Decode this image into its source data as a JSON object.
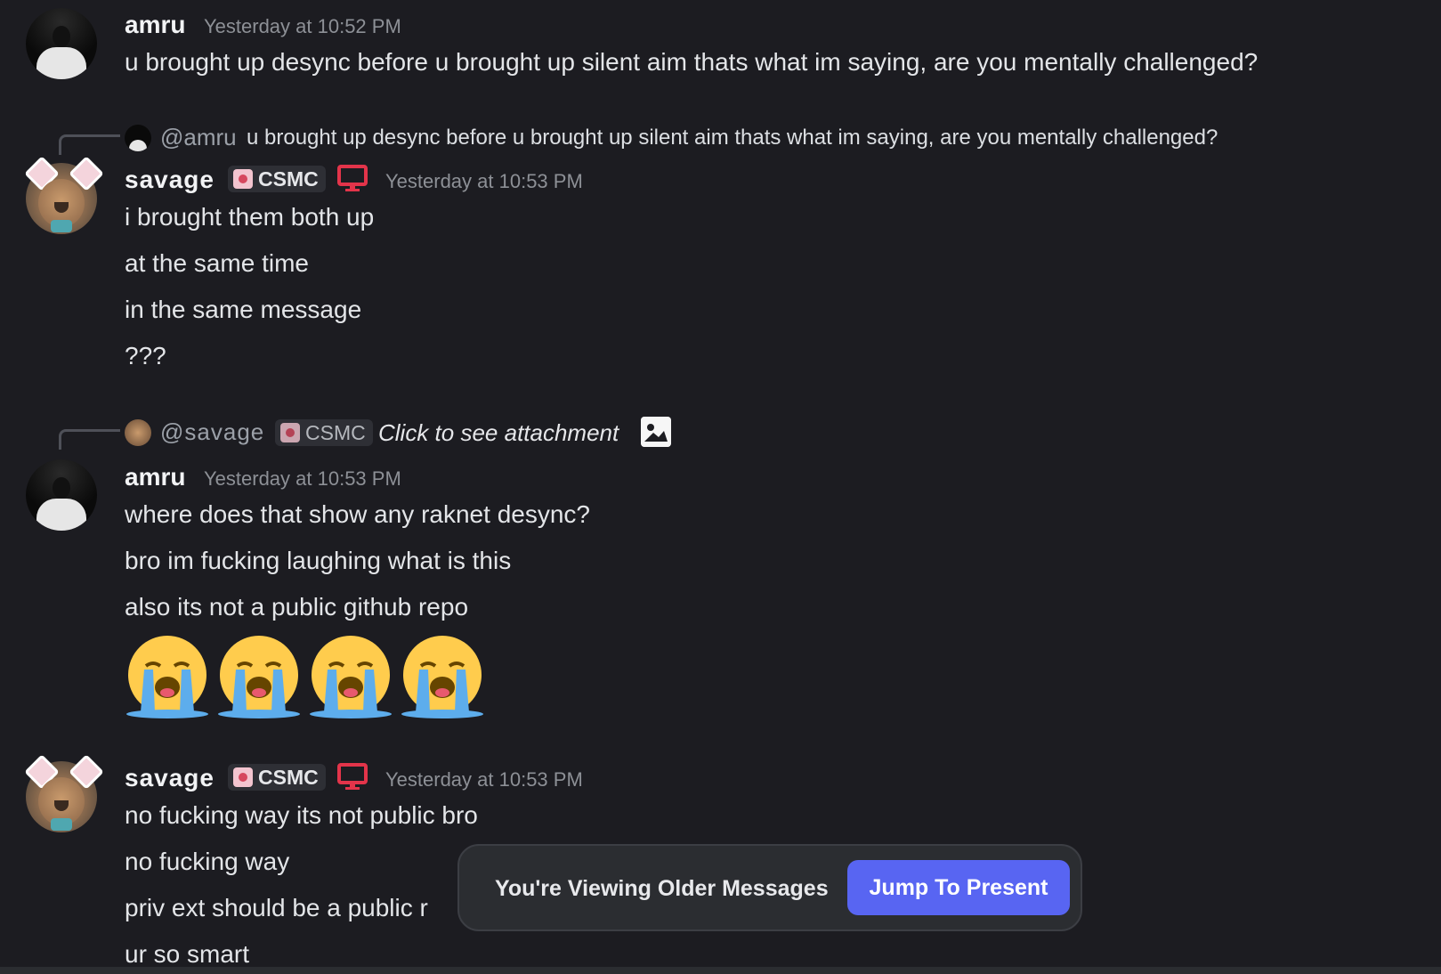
{
  "messages": [
    {
      "author": "amru",
      "timestamp": "Yesterday at 10:52 PM",
      "lines": [
        "u brought up desync before u brought up silent aim thats what im saying, are you mentally challenged?"
      ]
    },
    {
      "reply": {
        "mention": "@amru",
        "text": "u brought up desync before u brought up silent aim thats what im saying, are you mentally challenged?"
      },
      "author": "savage",
      "tag": "CSMC",
      "timestamp": "Yesterday at 10:53 PM",
      "lines": [
        "i brought them both up",
        "at the same time",
        "in the same message",
        "???"
      ]
    },
    {
      "reply": {
        "mention": "@savage",
        "tag": "CSMC",
        "text": "Click to see attachment"
      },
      "author": "amru",
      "timestamp": "Yesterday at 10:53 PM",
      "lines": [
        "where does that show any raknet desync?",
        "bro im fucking laughing what is this",
        "also its not a public github repo"
      ],
      "emojis": [
        "loudly-crying-face",
        "loudly-crying-face",
        "loudly-crying-face",
        "loudly-crying-face"
      ]
    },
    {
      "author": "savage",
      "tag": "CSMC",
      "timestamp": "Yesterday at 10:53 PM",
      "lines": [
        "no fucking way its not public bro",
        "no fucking way",
        "priv ext should be a public r",
        "ur so smart"
      ]
    }
  ],
  "banner": {
    "label": "You're Viewing Older Messages",
    "button": "Jump To Present"
  },
  "colors": {
    "background": "#1c1c21",
    "accent": "#5865f2",
    "device_icon": "#e3344a"
  }
}
